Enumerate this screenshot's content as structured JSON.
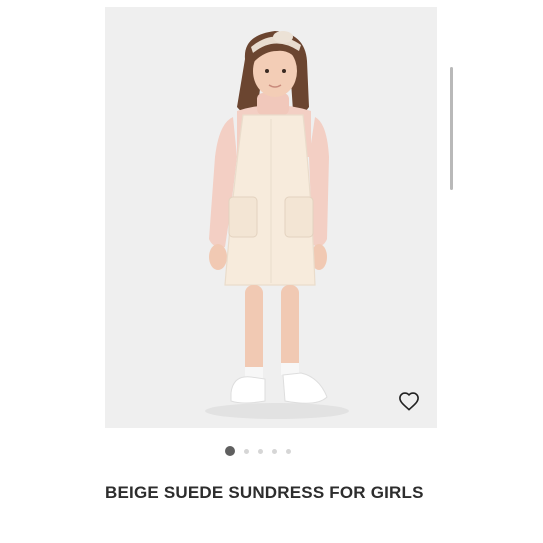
{
  "product": {
    "title": "BEIGE SUEDE SUNDRESS FOR GIRLS",
    "image_alt": "girl wearing beige suede sundress over pink turtleneck"
  },
  "gallery": {
    "total_images": 5,
    "active_index": 0
  },
  "favorite": {
    "icon": "heart-outline-icon",
    "active": false
  },
  "colors": {
    "image_background": "#efefef",
    "active_dot": "#5f5f5f",
    "inactive_dot": "#d6d6d6",
    "title_text": "#2d2d2d"
  }
}
